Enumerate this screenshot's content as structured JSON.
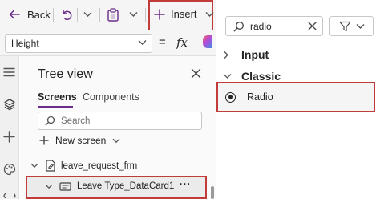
{
  "toolbar": {
    "back_label": "Back",
    "insert_label": "Insert",
    "icons": [
      "back-arrow-icon",
      "undo-icon",
      "chevron-down-icon",
      "clipboard-icon",
      "chevron-down-icon",
      "plus-icon",
      "chevron-down-icon"
    ]
  },
  "formula_bar": {
    "property": "Height",
    "equals": "=",
    "fx": "fx"
  },
  "rail_icons": [
    "hamburger-icon",
    "layers-icon",
    "plus-icon",
    "palette-icon",
    "variables-icon"
  ],
  "tree_view": {
    "title": "Tree view",
    "tabs": [
      "Screens",
      "Components"
    ],
    "active_tab": "Screens",
    "search_placeholder": "Search",
    "new_screen_label": "New screen",
    "nodes": [
      {
        "label": "leave_request_frm",
        "icon": "form-icon",
        "expanded": true
      },
      {
        "label": "Leave Type_DataCard1",
        "icon": "card-icon",
        "expanded": true,
        "more": "···"
      }
    ]
  },
  "insert_panel": {
    "search_value": "radio",
    "categories": [
      {
        "label": "Input",
        "expanded": false
      },
      {
        "label": "Classic",
        "expanded": true
      }
    ],
    "results": [
      {
        "label": "Radio",
        "icon": "radio-icon"
      }
    ]
  },
  "colors": {
    "accent": "#6b2d8a",
    "highlight_border": "#c23b3b",
    "panel_bg": "#f5f5f5"
  }
}
